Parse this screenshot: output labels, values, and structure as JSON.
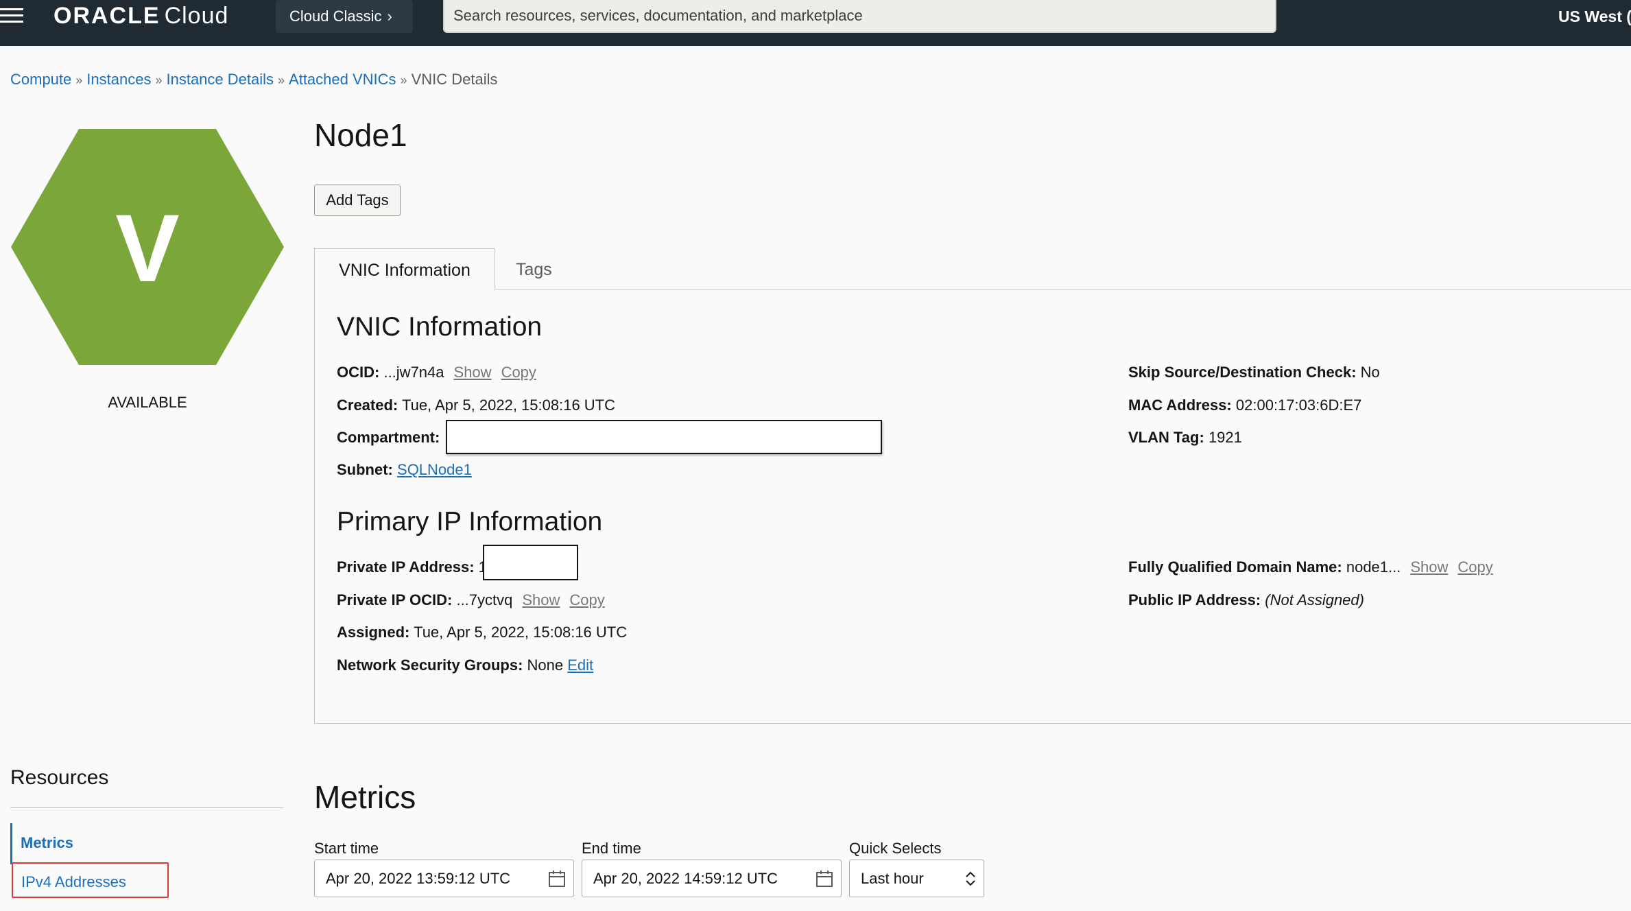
{
  "topbar": {
    "brand": "ORACLE",
    "product": "Cloud",
    "classic_label": "Cloud Classic",
    "search_placeholder": "Search resources, services, documentation, and marketplace",
    "region": "US West ("
  },
  "breadcrumb": {
    "items": [
      "Compute",
      "Instances",
      "Instance Details",
      "Attached VNICs"
    ],
    "current": "VNIC Details"
  },
  "resource": {
    "icon_letter": "V",
    "status": "AVAILABLE",
    "status_color": "#7aa63a",
    "title": "Node1",
    "add_tags_label": "Add Tags"
  },
  "tabs": [
    {
      "label": "VNIC Information",
      "active": true
    },
    {
      "label": "Tags",
      "active": false
    }
  ],
  "vnic_info": {
    "heading": "VNIC Information",
    "ocid_label": "OCID:",
    "ocid_value": "...jw7n4a",
    "show_label": "Show",
    "copy_label": "Copy",
    "created_label": "Created:",
    "created_value": "Tue, Apr 5, 2022, 15:08:16 UTC",
    "compartment_label": "Compartment:",
    "subnet_label": "Subnet:",
    "subnet_value": "SQLNode1",
    "skip_label": "Skip Source/Destination Check:",
    "skip_value": "No",
    "mac_label": "MAC Address:",
    "mac_value": "02:00:17:03:6D:E7",
    "vlan_label": "VLAN Tag:",
    "vlan_value": "1921"
  },
  "primary_ip": {
    "heading": "Primary IP Information",
    "private_ip_label": "Private IP Address:",
    "private_ip_partial": "1",
    "ocid_label": "Private IP OCID:",
    "ocid_value": "...7yctvq",
    "show_label": "Show",
    "copy_label": "Copy",
    "assigned_label": "Assigned:",
    "assigned_value": "Tue, Apr 5, 2022, 15:08:16 UTC",
    "nsg_label": "Network Security Groups:",
    "nsg_value": "None",
    "nsg_edit": "Edit",
    "fqdn_label": "Fully Qualified Domain Name:",
    "fqdn_value": "node1...",
    "public_ip_label": "Public IP Address:",
    "public_ip_value": "(Not Assigned)"
  },
  "resources": {
    "heading": "Resources",
    "items": [
      "Metrics",
      "IPv4 Addresses"
    ]
  },
  "metrics": {
    "heading": "Metrics",
    "start_label": "Start time",
    "start_value": "Apr 20, 2022 13:59:12 UTC",
    "end_label": "End time",
    "end_value": "Apr 20, 2022 14:59:12 UTC",
    "quick_label": "Quick Selects",
    "quick_value": "Last hour"
  }
}
